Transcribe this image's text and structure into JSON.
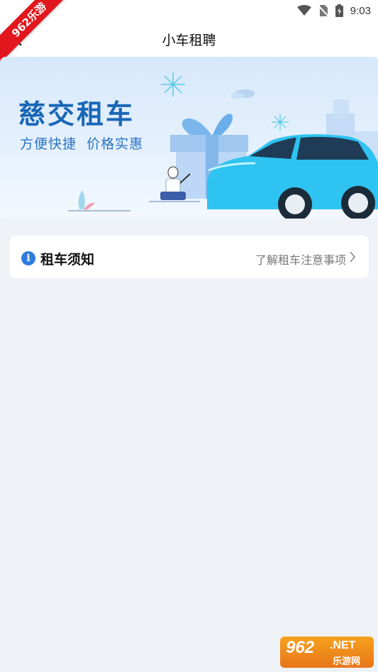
{
  "status_bar": {
    "time": "9:03"
  },
  "header": {
    "title": "小车租聘"
  },
  "ribbon": {
    "text": "962乐游"
  },
  "banner": {
    "title": "慈交租车",
    "subtitle": "方便快捷  价格实惠"
  },
  "notice": {
    "title": "租车须知",
    "link_text": "了解租车注意事项"
  },
  "watermark": {
    "main": "962",
    "dot": ".NET",
    "sub": "乐游网"
  },
  "colors": {
    "accent": "#2f7de1",
    "banner_text": "#1966b6",
    "car": "#2ec3f0"
  }
}
